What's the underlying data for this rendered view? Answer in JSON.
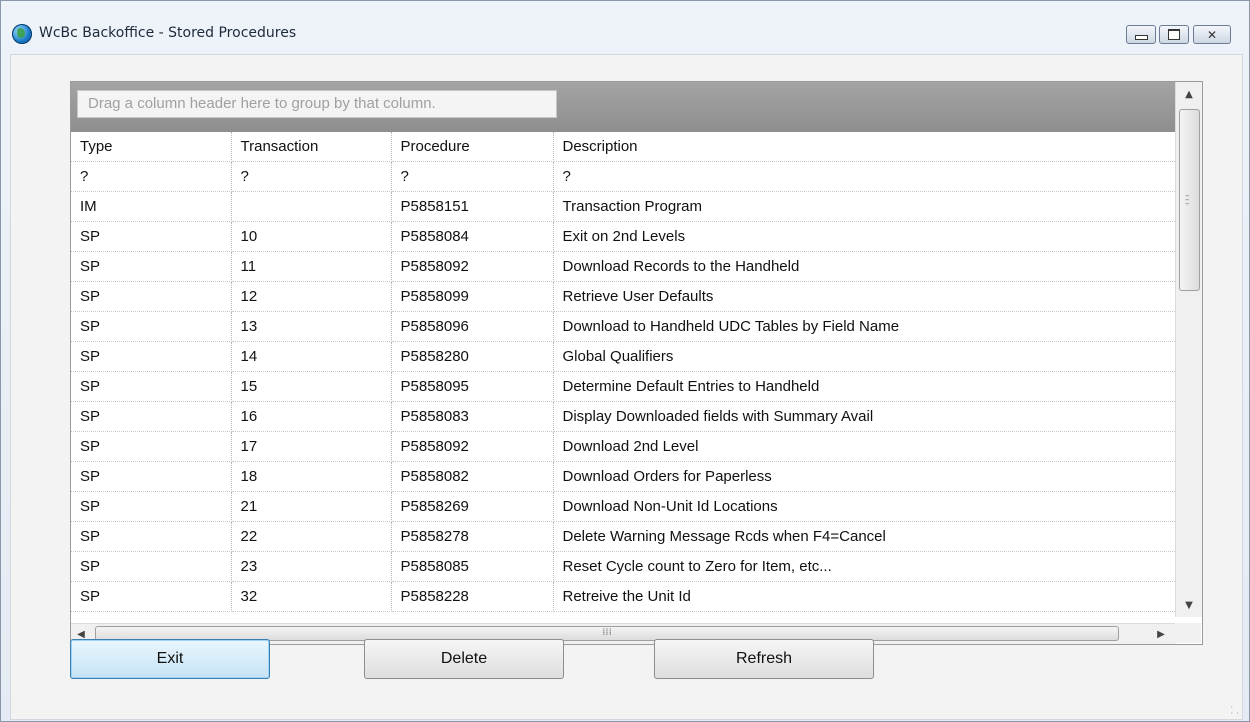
{
  "window": {
    "title": "WcBc Backoffice - Stored Procedures",
    "controls": {
      "minimize": "minimize",
      "maximize": "maximize",
      "close": "close"
    }
  },
  "grid": {
    "group_hint": "Drag a column header here to group by that column.",
    "columns": [
      "Type",
      "Transaction",
      "Procedure",
      "Description"
    ],
    "filter": [
      "?",
      "?",
      "?",
      "?"
    ],
    "rows": [
      [
        "IM",
        "",
        "P5858151",
        "Transaction Program"
      ],
      [
        "SP",
        "10",
        "P5858084",
        "Exit on 2nd Levels"
      ],
      [
        "SP",
        "11",
        "P5858092",
        "Download Records to the Handheld"
      ],
      [
        "SP",
        "12",
        "P5858099",
        "Retrieve User Defaults"
      ],
      [
        "SP",
        "13",
        "P5858096",
        "Download to Handheld UDC Tables by Field Name"
      ],
      [
        "SP",
        "14",
        "P5858280",
        "Global Qualifiers"
      ],
      [
        "SP",
        "15",
        "P5858095",
        "Determine Default Entries to Handheld"
      ],
      [
        "SP",
        "16",
        "P5858083",
        "Display Downloaded fields with Summary Avail"
      ],
      [
        "SP",
        "17",
        "P5858092",
        "Download 2nd Level"
      ],
      [
        "SP",
        "18",
        "P5858082",
        "Download Orders for Paperless"
      ],
      [
        "SP",
        "21",
        "P5858269",
        "Download Non-Unit Id Locations"
      ],
      [
        "SP",
        "22",
        "P5858278",
        "Delete Warning Message Rcds when F4=Cancel"
      ],
      [
        "SP",
        "23",
        "P5858085",
        "Reset Cycle count to Zero for Item, etc..."
      ],
      [
        "SP",
        "32",
        "P5858228",
        "Retreive the Unit Id"
      ]
    ]
  },
  "buttons": {
    "exit": "Exit",
    "delete": "Delete",
    "refresh": "Refresh"
  },
  "colors": {
    "title_bar": "#eef3f9",
    "group_panel": "#9a9a9a",
    "exit_focus": "#3c7fb1"
  }
}
